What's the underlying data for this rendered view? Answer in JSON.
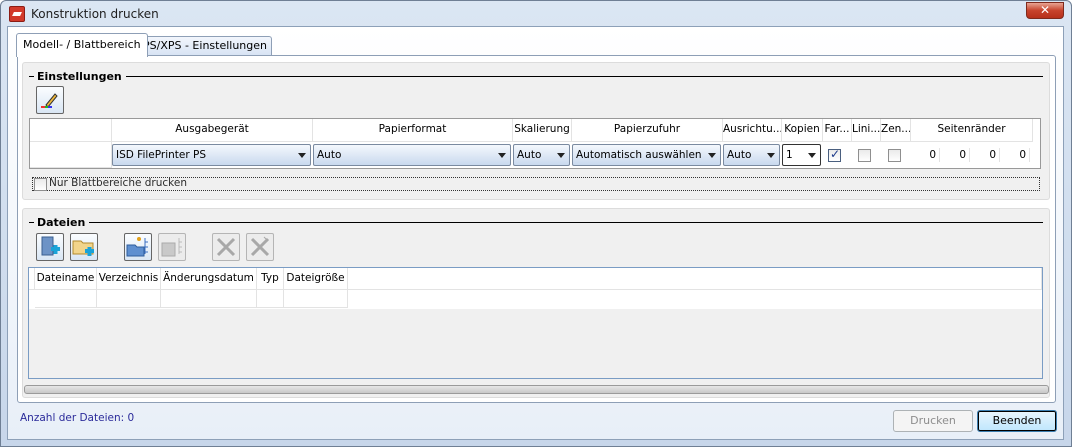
{
  "window": {
    "title": "Konstruktion drucken",
    "close_icon": "close-icon"
  },
  "tabs": [
    {
      "label": "Modell- / Blattbereich",
      "active": true
    },
    {
      "label": "PS/XPS - Einstellungen",
      "active": false
    }
  ],
  "settings": {
    "title": "Einstellungen",
    "edit_icon": "pen-color-icon",
    "columns": [
      "Ausgabegerät",
      "Papierformat",
      "Skalierung",
      "Papierzufuhr",
      "Ausrichtu...",
      "Kopien",
      "Far...",
      "Lini...",
      "Zen...",
      "Seitenränder"
    ],
    "row": {
      "ausgabegeraet": "ISD FilePrinter PS",
      "papierformat": "Auto",
      "skalierung": "Auto",
      "papierzufuhr": "Automatisch auswählen",
      "ausrichtung": "Auto",
      "kopien": "1",
      "farbe": true,
      "linien": false,
      "zentriert": false,
      "raender": [
        "0",
        "0",
        "0",
        "0"
      ]
    },
    "nur_blattbereiche_label": "Nur Blattbereiche drucken",
    "nur_blattbereiche_checked": false
  },
  "files": {
    "title": "Dateien",
    "toolbar": [
      {
        "icon": "add-file-icon",
        "enabled": true
      },
      {
        "icon": "add-folder-icon",
        "enabled": true
      },
      {
        "icon": "open-folder-tree-icon",
        "enabled": true
      },
      {
        "icon": "save-tree-icon",
        "enabled": false
      },
      {
        "icon": "delete-icon",
        "enabled": false
      },
      {
        "icon": "delete-all-icon",
        "enabled": false
      }
    ],
    "columns": [
      "Dateiname",
      "Verzeichnis",
      "Änderungsdatum",
      "Typ",
      "Dateigröße"
    ],
    "rows": []
  },
  "footer": {
    "count_label": "Anzahl der Dateien: 0",
    "print_label": "Drucken",
    "close_label": "Beenden"
  }
}
